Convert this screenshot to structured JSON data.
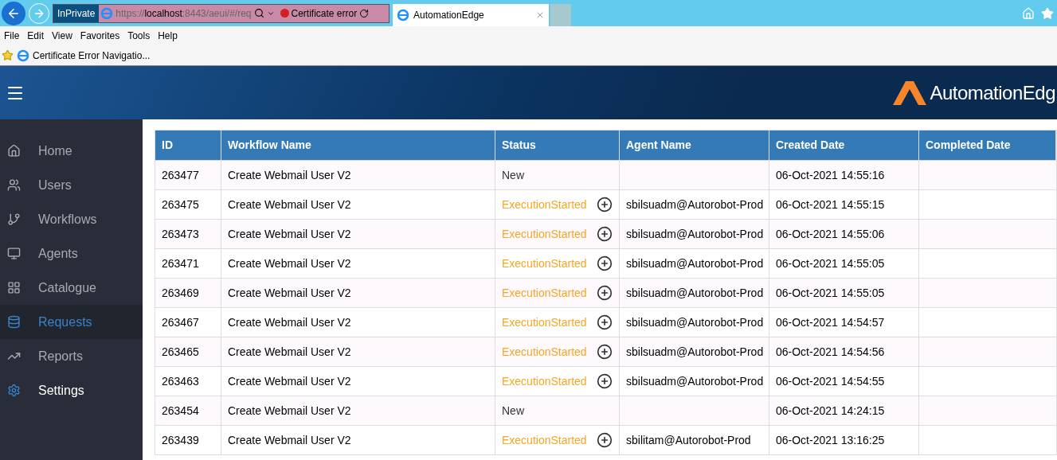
{
  "browser": {
    "private_label": "InPrivate",
    "url": {
      "prefix": "https://",
      "host": "localhost",
      "rest": ":8443/aeui/#/req"
    },
    "cert_error": "Certificate error",
    "tabs": [
      {
        "title": "AutomationEdge",
        "selected": true
      }
    ]
  },
  "menu": [
    "File",
    "Edit",
    "View",
    "Favorites",
    "Tools",
    "Help"
  ],
  "favorites": [
    {
      "title": "Certificate Error Navigatio..."
    }
  ],
  "app": {
    "logo": "AutomationEdg"
  },
  "sidebar": {
    "items": [
      {
        "label": "Home",
        "selected": false,
        "hovered": false
      },
      {
        "label": "Users",
        "selected": false,
        "hovered": false
      },
      {
        "label": "Workflows",
        "selected": false,
        "hovered": false
      },
      {
        "label": "Agents",
        "selected": false,
        "hovered": false
      },
      {
        "label": "Catalogue",
        "selected": false,
        "hovered": false
      },
      {
        "label": "Requests",
        "selected": true,
        "hovered": false
      },
      {
        "label": "Reports",
        "selected": false,
        "hovered": false
      },
      {
        "label": "Settings",
        "selected": false,
        "hovered": true
      }
    ]
  },
  "table": {
    "columns": [
      "ID",
      "Workflow Name",
      "Status",
      "Agent Name",
      "Created Date",
      "Completed Date"
    ],
    "rows": [
      {
        "id": "263477",
        "workflow": "Create Webmail User V2",
        "status": "New",
        "kind": "new",
        "agent": "",
        "created": "06-Oct-2021 14:55:16"
      },
      {
        "id": "263475",
        "workflow": "Create Webmail User V2",
        "status": "ExecutionStarted",
        "kind": "started",
        "agent": "sbilsuadm@Autorobot-Prod",
        "created": "06-Oct-2021 14:55:15"
      },
      {
        "id": "263473",
        "workflow": "Create Webmail User V2",
        "status": "ExecutionStarted",
        "kind": "started",
        "agent": "sbilsuadm@Autorobot-Prod",
        "created": "06-Oct-2021 14:55:06"
      },
      {
        "id": "263471",
        "workflow": "Create Webmail User V2",
        "status": "ExecutionStarted",
        "kind": "started",
        "agent": "sbilsuadm@Autorobot-Prod",
        "created": "06-Oct-2021 14:55:05"
      },
      {
        "id": "263469",
        "workflow": "Create Webmail User V2",
        "status": "ExecutionStarted",
        "kind": "started",
        "agent": "sbilsuadm@Autorobot-Prod",
        "created": "06-Oct-2021 14:55:05"
      },
      {
        "id": "263467",
        "workflow": "Create Webmail User V2",
        "status": "ExecutionStarted",
        "kind": "started",
        "agent": "sbilsuadm@Autorobot-Prod",
        "created": "06-Oct-2021 14:54:57"
      },
      {
        "id": "263465",
        "workflow": "Create Webmail User V2",
        "status": "ExecutionStarted",
        "kind": "started",
        "agent": "sbilsuadm@Autorobot-Prod",
        "created": "06-Oct-2021 14:54:56"
      },
      {
        "id": "263463",
        "workflow": "Create Webmail User V2",
        "status": "ExecutionStarted",
        "kind": "started",
        "agent": "sbilsuadm@Autorobot-Prod",
        "created": "06-Oct-2021 14:54:55"
      },
      {
        "id": "263454",
        "workflow": "Create Webmail User V2",
        "status": "New",
        "kind": "new",
        "agent": "",
        "created": "06-Oct-2021 14:24:15"
      },
      {
        "id": "263439",
        "workflow": "Create Webmail User V2",
        "status": "ExecutionStarted",
        "kind": "started",
        "agent": "sbilitam@Autorobot-Prod",
        "created": "06-Oct-2021 13:16:25"
      }
    ]
  }
}
